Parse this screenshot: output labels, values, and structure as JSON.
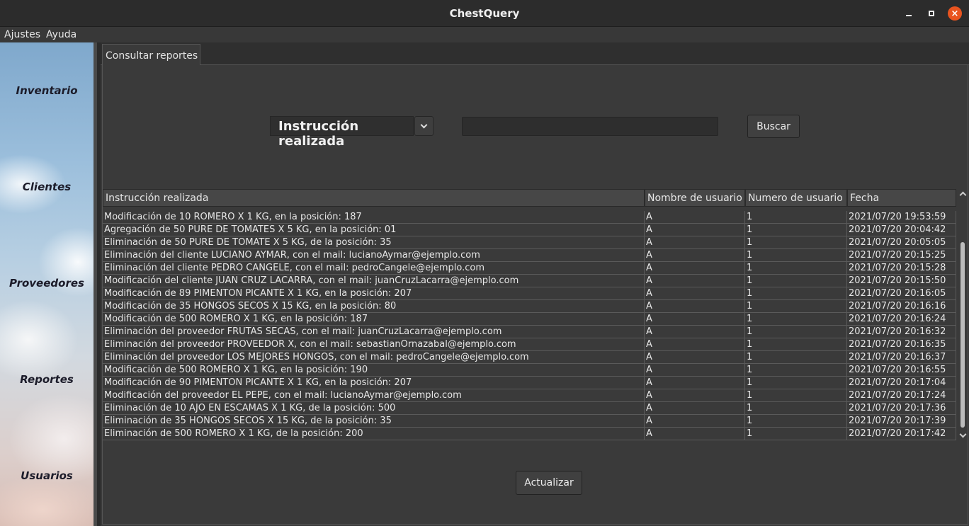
{
  "window": {
    "title": "ChestQuery",
    "close_glyph": "×"
  },
  "menu": {
    "items": [
      "Ajustes",
      "Ayuda"
    ]
  },
  "sidebar": {
    "items": [
      "Inventario",
      "Clientes",
      "Proveedores",
      "Reportes",
      "Usuarios"
    ]
  },
  "tabs": [
    {
      "label": "Consultar reportes"
    }
  ],
  "filter": {
    "selected": "Instrucción realizada",
    "search_value": ""
  },
  "buttons": {
    "search": "Buscar",
    "refresh": "Actualizar"
  },
  "table": {
    "columns": [
      "Instrucción realizada",
      "Nombre de usuario",
      "Numero de usuario",
      "Fecha"
    ],
    "rows": [
      [
        "Modificación de 10 ROMERO X 1 KG, en la posición: 187",
        "A",
        "1",
        "2021/07/20 19:53:59"
      ],
      [
        "Agregación de 50 PURE DE TOMATES X 5 KG, en la posición: 01",
        "A",
        "1",
        "2021/07/20 20:04:42"
      ],
      [
        "Eliminación de 50 PURE DE TOMATE X 5 KG, de la posición: 35",
        "A",
        "1",
        "2021/07/20 20:05:05"
      ],
      [
        "Eliminación del cliente LUCIANO AYMAR, con el mail: lucianoAymar@ejemplo.com",
        "A",
        "1",
        "2021/07/20 20:15:25"
      ],
      [
        "Eliminación del cliente PEDRO CANGELE, con el mail: pedroCangele@ejemplo.com",
        "A",
        "1",
        "2021/07/20 20:15:28"
      ],
      [
        "Modificación del cliente JUAN CRUZ LACARRA, con el mail: juanCruzLacarra@ejemplo.com",
        "A",
        "1",
        "2021/07/20 20:15:50"
      ],
      [
        "Modificación de 89 PIMENTON PICANTE X 1 KG, en la posición: 207",
        "A",
        "1",
        "2021/07/20 20:16:05"
      ],
      [
        "Modificación de 35 HONGOS SECOS X 15 KG, en la posición: 80",
        "A",
        "1",
        "2021/07/20 20:16:16"
      ],
      [
        "Modificación de 500 ROMERO X 1 KG, en la posición: 187",
        "A",
        "1",
        "2021/07/20 20:16:24"
      ],
      [
        "Eliminación del proveedor FRUTAS SECAS, con el mail: juanCruzLacarra@ejemplo.com",
        "A",
        "1",
        "2021/07/20 20:16:32"
      ],
      [
        "Eliminación del proveedor PROVEEDOR X, con el mail: sebastianOrnazabal@ejemplo.com",
        "A",
        "1",
        "2021/07/20 20:16:35"
      ],
      [
        "Eliminación del proveedor LOS MEJORES HONGOS, con el mail: pedroCangele@ejemplo.com",
        "A",
        "1",
        "2021/07/20 20:16:37"
      ],
      [
        "Modificación de 500 ROMERO X 1 KG, en la posición: 190",
        "A",
        "1",
        "2021/07/20 20:16:55"
      ],
      [
        "Modificación de 90 PIMENTON PICANTE X 1 KG, en la posición: 207",
        "A",
        "1",
        "2021/07/20 20:17:04"
      ],
      [
        "Modificación del proveedor EL PEPE, con el mail: lucianoAymar@ejemplo.com",
        "A",
        "1",
        "2021/07/20 20:17:24"
      ],
      [
        "Eliminación de 10 AJO EN ESCAMAS X 1 KG, de la posición: 500",
        "A",
        "1",
        "2021/07/20 20:17:36"
      ],
      [
        "Eliminación de 35 HONGOS SECOS X 15 KG, de la posición: 35",
        "A",
        "1",
        "2021/07/20 20:17:39"
      ],
      [
        "Eliminación de 500 ROMERO X 1 KG, de la posición: 200",
        "A",
        "1",
        "2021/07/20 20:17:42"
      ]
    ]
  },
  "colors": {
    "close_button": "#e9541f",
    "panel_bg": "#3a3a3a"
  }
}
